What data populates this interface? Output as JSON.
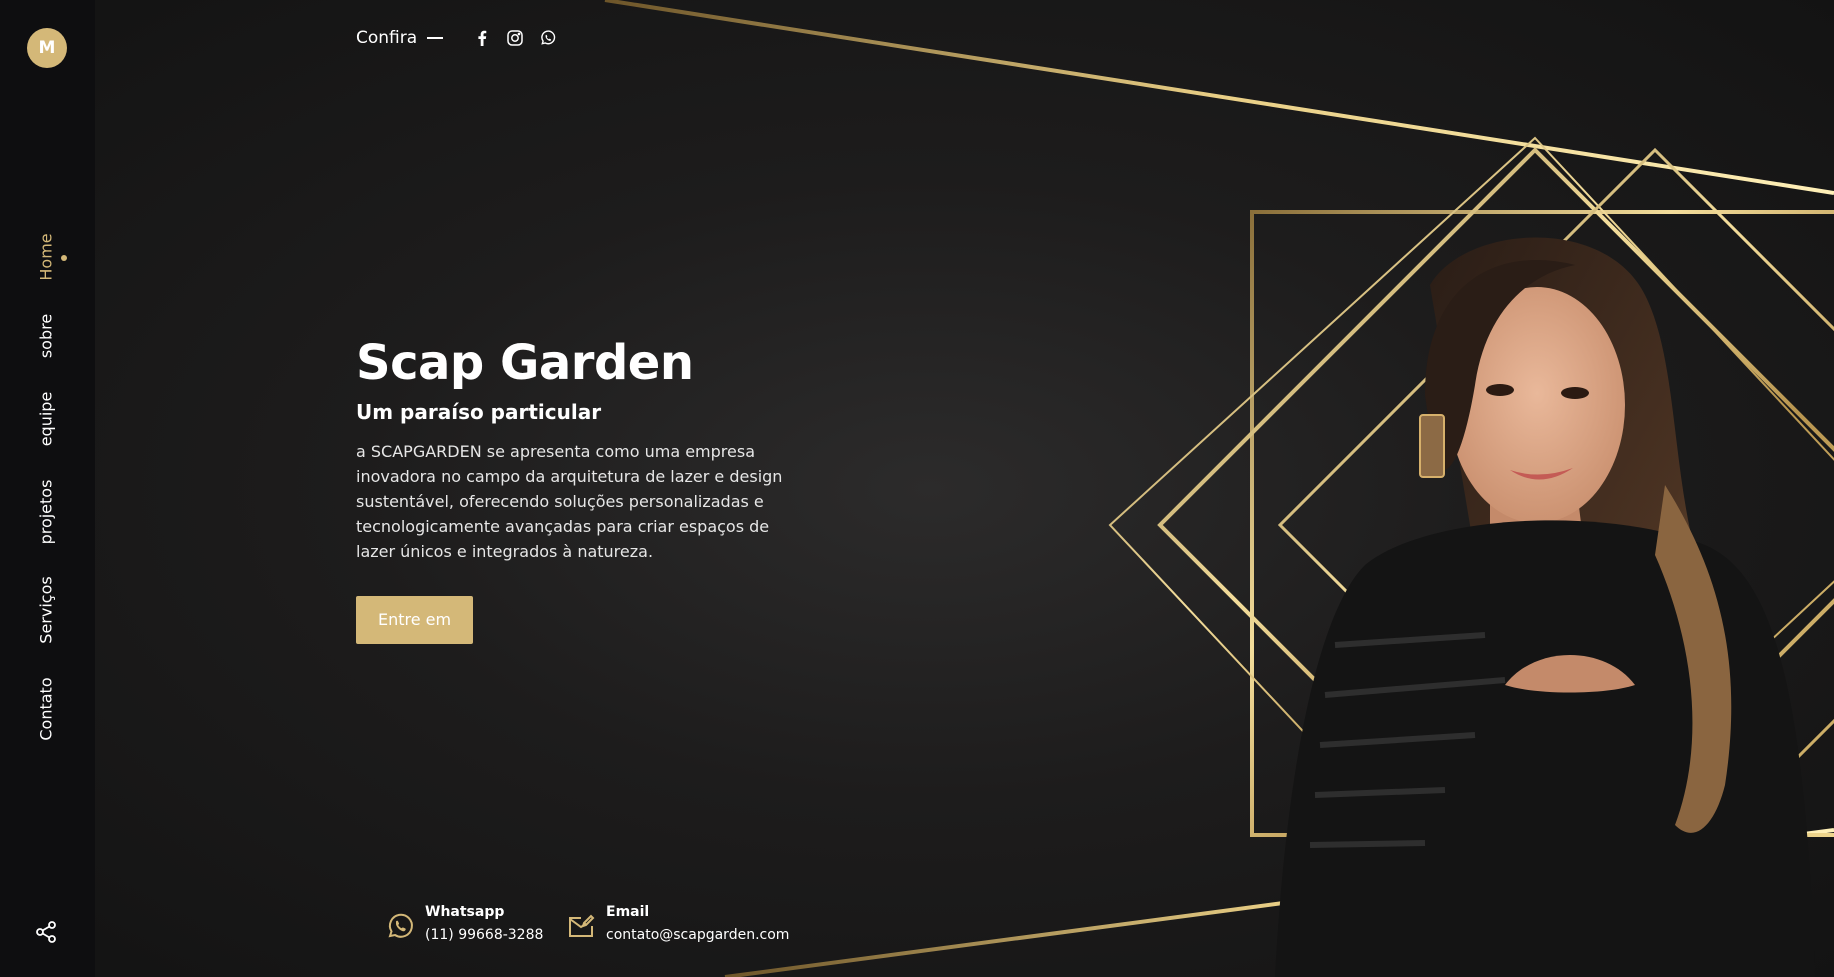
{
  "brand": {
    "logo_letter": "M",
    "accent_color": "#d4b878"
  },
  "sidebar": {
    "items": [
      {
        "label": "Home",
        "active": true
      },
      {
        "label": "sobre",
        "active": false
      },
      {
        "label": "equipe",
        "active": false
      },
      {
        "label": "projetos",
        "active": false
      },
      {
        "label": "Serviços",
        "active": false
      },
      {
        "label": "Contato",
        "active": false
      }
    ],
    "share_icon": "share-icon"
  },
  "topbar": {
    "label": "Confira",
    "social_icons": [
      "facebook-icon",
      "instagram-icon",
      "whatsapp-icon"
    ]
  },
  "hero": {
    "title": "Scap Garden",
    "subtitle": "Um paraíso particular",
    "description": "a SCAPGARDEN se apresenta como uma empresa inovadora no campo da arquitetura de lazer e design sustentável, oferecendo soluções personalizadas e tecnologicamente avançadas para criar espaços de lazer únicos e integrados à natureza.",
    "cta_label": "Entre em"
  },
  "contacts": [
    {
      "title": "Whatsapp",
      "value": "(11) 99668-3288",
      "icon": "whatsapp-icon"
    },
    {
      "title": "Email",
      "value": "contato@scapgarden.com",
      "icon": "email-icon"
    }
  ]
}
